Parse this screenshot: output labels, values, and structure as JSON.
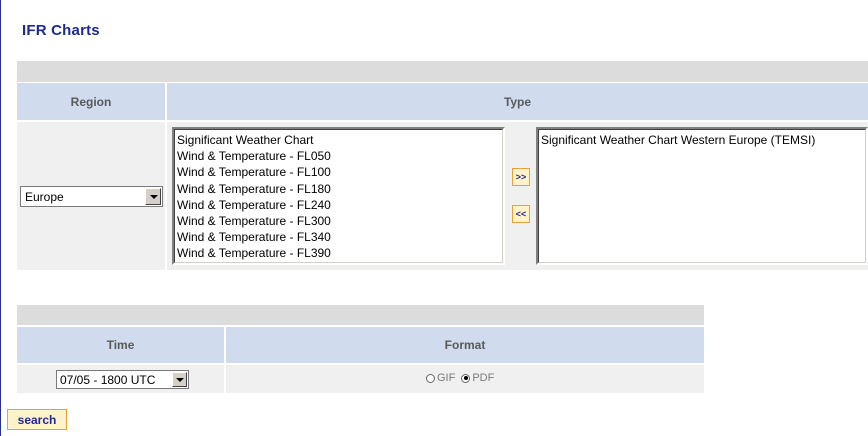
{
  "page": {
    "title": "IFR Charts"
  },
  "table1": {
    "region_header": "Region",
    "type_header": "Type",
    "region_select": "Europe",
    "available_types": [
      "Significant Weather Chart",
      "Wind & Temperature - FL050",
      "Wind & Temperature - FL100",
      "Wind & Temperature - FL180",
      "Wind & Temperature - FL240",
      "Wind & Temperature - FL300",
      "Wind & Temperature - FL340",
      "Wind & Temperature - FL390"
    ],
    "selected_types": [
      "Significant Weather Chart Western Europe (TEMSI)"
    ],
    "add_button": ">>",
    "remove_button": "<<"
  },
  "table2": {
    "time_header": "Time",
    "format_header": "Format",
    "time_select": "07/05 - 1800 UTC",
    "format_options": [
      {
        "label": "GIF",
        "checked": false
      },
      {
        "label": "PDF",
        "checked": true
      }
    ]
  },
  "search_button": "search",
  "colors": {
    "title": "#1f2a8c",
    "header_bg": "#d0dbee",
    "bar_bg": "#dcdcdc",
    "row_bg": "#f0f0f0",
    "button_bg": "#fff3cc",
    "button_border": "#e8a23a"
  }
}
